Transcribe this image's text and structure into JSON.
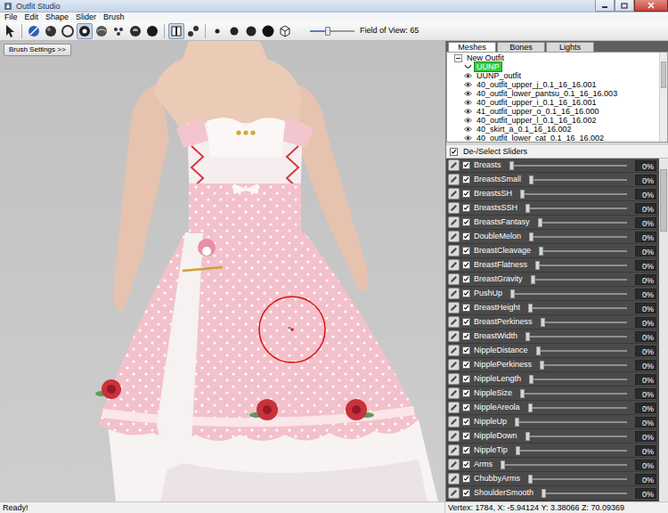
{
  "window": {
    "title": "Outfit Studio"
  },
  "menu": [
    "File",
    "Edit",
    "Shape",
    "Slider",
    "Brush"
  ],
  "toolbar": {
    "tools": [
      {
        "kind": "select",
        "selected": false
      },
      {
        "kind": "separator"
      },
      {
        "kind": "mask",
        "selected": false
      },
      {
        "kind": "inflate",
        "selected": false
      },
      {
        "kind": "deflate",
        "selected": false
      },
      {
        "kind": "move",
        "selected": true
      },
      {
        "kind": "smooth",
        "selected": false
      },
      {
        "kind": "undiff",
        "selected": false
      },
      {
        "kind": "weight",
        "selected": false
      },
      {
        "kind": "color",
        "selected": false
      },
      {
        "kind": "separator"
      },
      {
        "kind": "mirror",
        "selected": true
      },
      {
        "kind": "connect",
        "selected": false
      },
      {
        "kind": "separator"
      },
      {
        "kind": "vertices",
        "selected": false
      },
      {
        "kind": "wireframe",
        "selected": false
      },
      {
        "kind": "lighting",
        "selected": false
      },
      {
        "kind": "texture",
        "selected": false
      },
      {
        "kind": "cube",
        "selected": false
      }
    ],
    "fov": {
      "label": "Field of View: 65",
      "level": 0.4
    }
  },
  "brush_settings": "Brush Settings >>",
  "tabs": [
    {
      "label": "Meshes",
      "selected": true
    },
    {
      "label": "Bones",
      "selected": false
    },
    {
      "label": "Lights",
      "selected": false
    }
  ],
  "tree": {
    "root": {
      "label": "New Outfit",
      "expanded": true
    },
    "items": [
      {
        "label": "UUNP",
        "kind": "reference",
        "selected": true
      },
      {
        "label": "UUNP_outfit",
        "kind": "mesh",
        "selected": false
      },
      {
        "label": "40_outfit_upper_j_0.1_16_16.001",
        "kind": "mesh",
        "selected": false
      },
      {
        "label": "40_outfit_lower_pantsu_0.1_16_16.003",
        "kind": "mesh",
        "selected": false
      },
      {
        "label": "40_outfit_upper_i_0.1_16_16.001",
        "kind": "mesh",
        "selected": false
      },
      {
        "label": "41_outfit_upper_o_0.1_16_16.000",
        "kind": "mesh",
        "selected": false
      },
      {
        "label": "40_outfit_upper_l_0.1_16_16.002",
        "kind": "mesh",
        "selected": false
      },
      {
        "label": "40_skirt_a_0.1_16_16.002",
        "kind": "mesh",
        "selected": false
      },
      {
        "label": "40_outfit_lower_cat_0.1_16_16.002",
        "kind": "mesh",
        "selected": false
      }
    ]
  },
  "slider_header": {
    "label": "De-/Select Sliders",
    "checked": true
  },
  "sliders": [
    {
      "name": "Breasts",
      "checked": true,
      "level": 0,
      "value": "0%"
    },
    {
      "name": "BreastsSmall",
      "checked": true,
      "level": 0,
      "value": "0%"
    },
    {
      "name": "BreastsSH",
      "checked": true,
      "level": 0,
      "value": "0%"
    },
    {
      "name": "BreastsSSH",
      "checked": true,
      "level": 0,
      "value": "0%"
    },
    {
      "name": "BreastsFantasy",
      "checked": true,
      "level": 0,
      "value": "0%"
    },
    {
      "name": "DoubleMelon",
      "checked": true,
      "level": 0,
      "value": "0%"
    },
    {
      "name": "BreastCleavage",
      "checked": true,
      "level": 0,
      "value": "0%"
    },
    {
      "name": "BreastFlatness",
      "checked": true,
      "level": 0,
      "value": "0%"
    },
    {
      "name": "BreastGravity",
      "checked": true,
      "level": 0,
      "value": "0%"
    },
    {
      "name": "PushUp",
      "checked": true,
      "level": 0,
      "value": "0%"
    },
    {
      "name": "BreastHeight",
      "checked": true,
      "level": 0,
      "value": "0%"
    },
    {
      "name": "BreastPerkiness",
      "checked": true,
      "level": 0,
      "value": "0%"
    },
    {
      "name": "BreastWidth",
      "checked": true,
      "level": 0,
      "value": "0%"
    },
    {
      "name": "NippleDistance",
      "checked": true,
      "level": 0,
      "value": "0%"
    },
    {
      "name": "NipplePerkiness",
      "checked": true,
      "level": 0,
      "value": "0%"
    },
    {
      "name": "NippleLength",
      "checked": true,
      "level": 0,
      "value": "0%"
    },
    {
      "name": "NippleSize",
      "checked": true,
      "level": 0,
      "value": "0%"
    },
    {
      "name": "NippleAreola",
      "checked": true,
      "level": 0,
      "value": "0%"
    },
    {
      "name": "NippleUp",
      "checked": true,
      "level": 0,
      "value": "0%"
    },
    {
      "name": "NippleDown",
      "checked": true,
      "level": 0,
      "value": "0%"
    },
    {
      "name": "NippleTip",
      "checked": true,
      "level": 0,
      "value": "0%"
    },
    {
      "name": "Arms",
      "checked": true,
      "level": 0,
      "value": "0%"
    },
    {
      "name": "ChubbyArms",
      "checked": true,
      "level": 0,
      "value": "0%"
    },
    {
      "name": "ShoulderSmooth",
      "checked": true,
      "level": 0,
      "value": "0%"
    }
  ],
  "status_bar": {
    "message": "Ready!",
    "vertex": "Vertex: 1784, X: -5.94124 Y: 3.38066 Z: 70.09369"
  }
}
